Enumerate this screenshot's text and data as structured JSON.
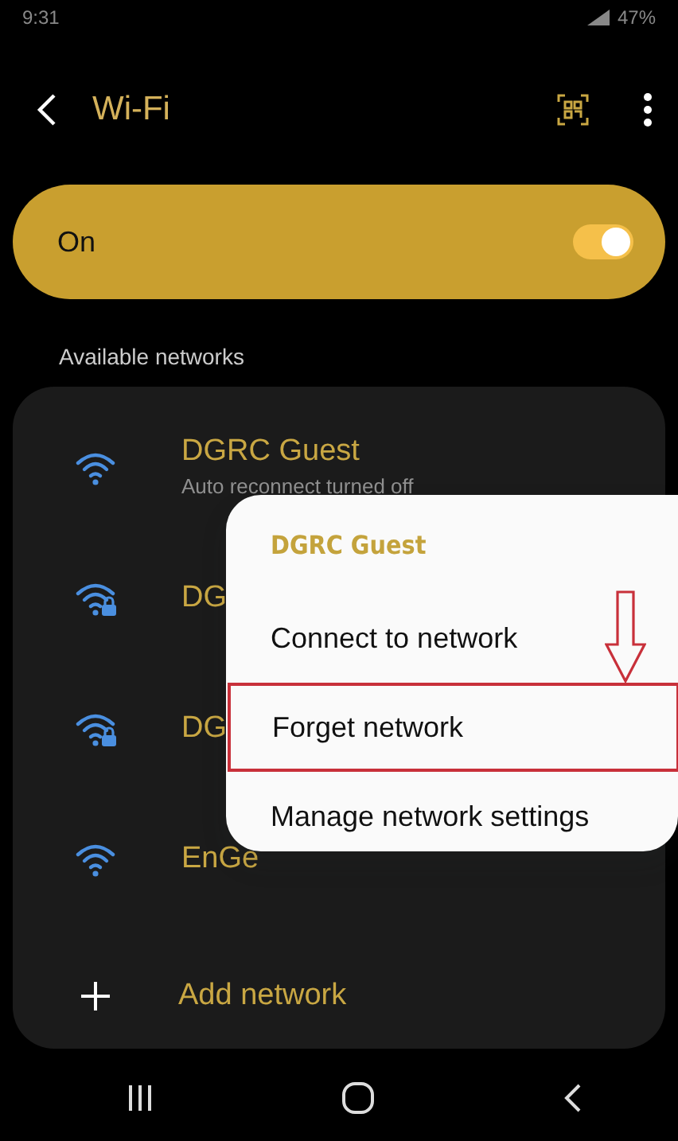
{
  "status_bar": {
    "time": "9:31",
    "battery": "47%"
  },
  "header": {
    "title": "Wi-Fi"
  },
  "master_switch": {
    "label": "On",
    "on": true
  },
  "section_title": "Available networks",
  "networks": [
    {
      "name": "DGRC Guest",
      "subtitle": "Auto reconnect turned off",
      "locked": false
    },
    {
      "name": "DG",
      "locked": true
    },
    {
      "name": "DG",
      "locked": true
    },
    {
      "name": "EnGe",
      "locked": false
    }
  ],
  "add_network": "Add network",
  "context_menu": {
    "title": "DGRC Guest",
    "items": [
      {
        "label": "Connect to network",
        "highlighted": false
      },
      {
        "label": "Forget network",
        "highlighted": true
      },
      {
        "label": "Manage network settings",
        "highlighted": false
      }
    ]
  }
}
